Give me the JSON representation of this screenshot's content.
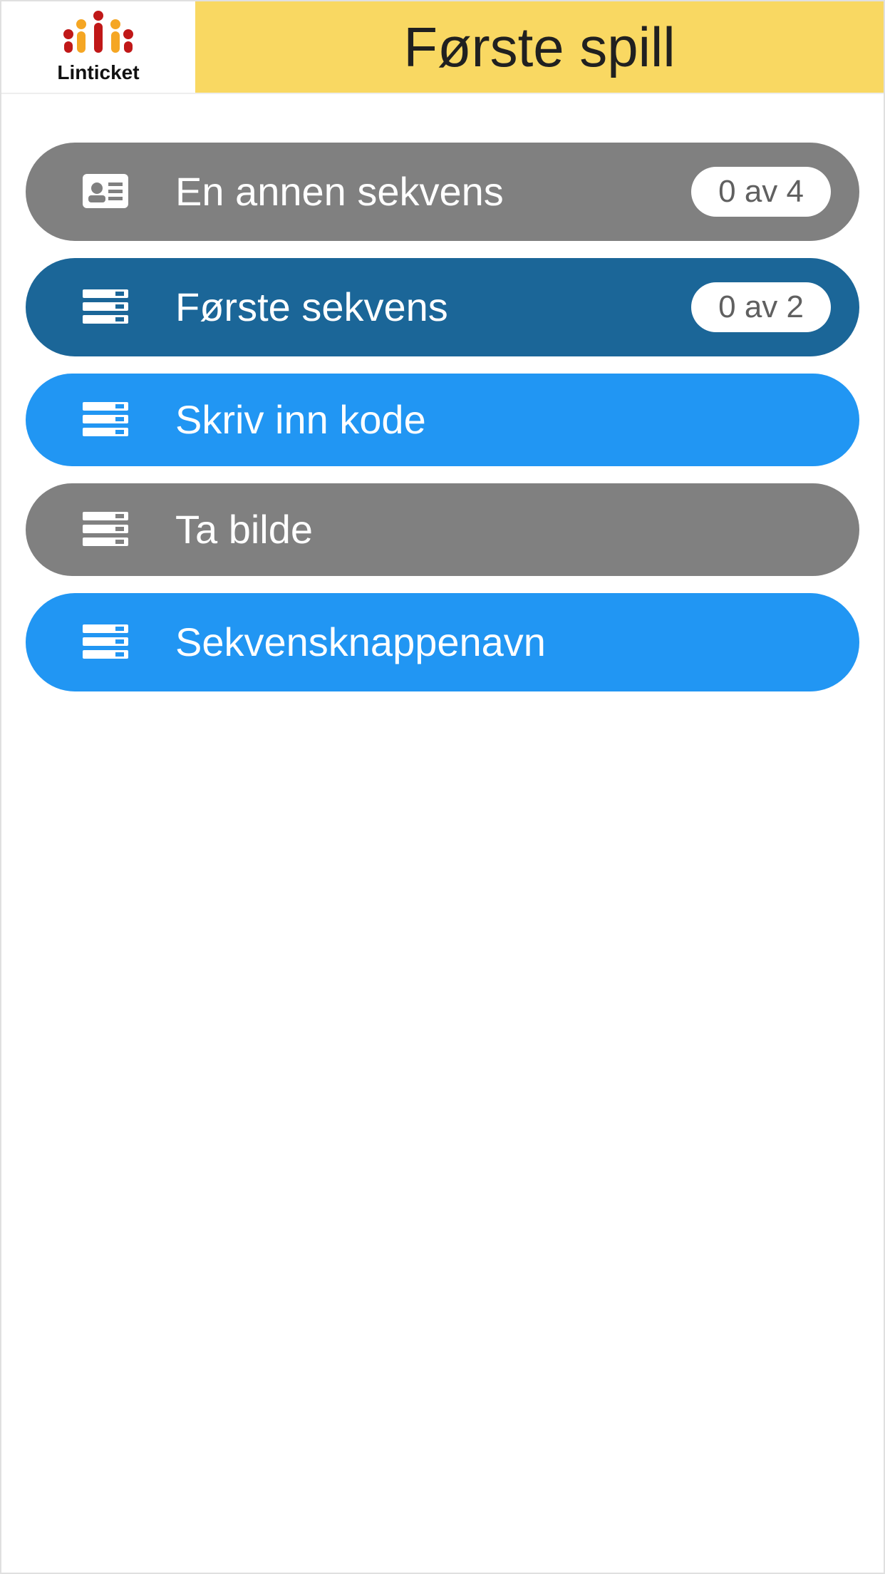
{
  "header": {
    "brand": "Linticket",
    "title": "Første spill"
  },
  "items": [
    {
      "label": "En annen sekvens",
      "badge": "0 av 4",
      "style": "gray",
      "icon": "id-card"
    },
    {
      "label": "Første sekvens",
      "badge": "0 av 2",
      "style": "darkblue",
      "icon": "server"
    },
    {
      "label": "Skriv inn kode",
      "badge": null,
      "style": "blue",
      "icon": "server"
    },
    {
      "label": "Ta bilde",
      "badge": null,
      "style": "gray",
      "icon": "server"
    },
    {
      "label": "Sekvensknappenavn",
      "badge": null,
      "style": "blue",
      "icon": "server"
    }
  ]
}
